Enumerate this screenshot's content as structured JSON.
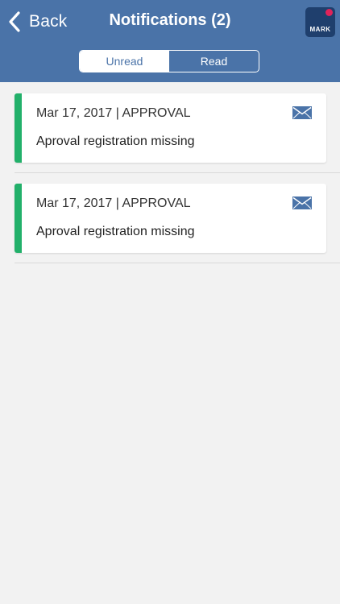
{
  "header": {
    "back_label": "Back",
    "title": "Notifications (2)",
    "logo_text": "MARK",
    "background_color": "#4a73a8"
  },
  "tabs": [
    {
      "label": "Unread",
      "selected": true
    },
    {
      "label": "Read",
      "selected": false
    }
  ],
  "notifications": [
    {
      "meta": "Mar 17, 2017 | APPROVAL",
      "message": "Aproval registration missing",
      "status_color": "#22b06a",
      "icon": "envelope-icon"
    },
    {
      "meta": "Mar 17, 2017 | APPROVAL",
      "message": "Aproval registration missing",
      "status_color": "#22b06a",
      "icon": "envelope-icon"
    }
  ]
}
